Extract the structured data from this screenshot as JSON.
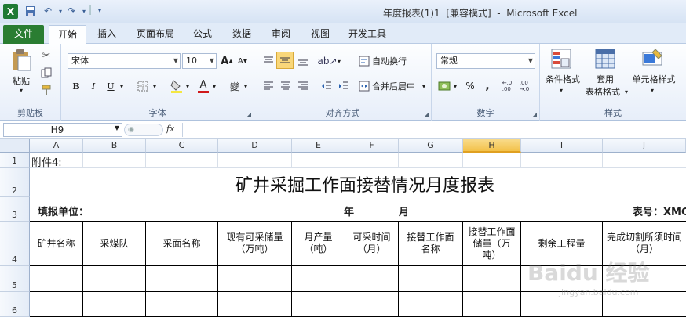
{
  "window": {
    "title": "年度报表(1)1  [兼容模式]  -  Microsoft Excel"
  },
  "quick_access": {
    "separator": "|"
  },
  "tabs": [
    "文件",
    "开始",
    "插入",
    "页面布局",
    "公式",
    "数据",
    "审阅",
    "视图",
    "开发工具"
  ],
  "clipboard": {
    "paste": "粘贴",
    "label": "剪贴板"
  },
  "font": {
    "name": "宋体",
    "size": "10",
    "bold": "B",
    "italic": "I",
    "underline": "U",
    "grow": "A",
    "shrink": "A",
    "color_a": "A",
    "phonetic": "變",
    "label": "字体"
  },
  "alignment": {
    "wrap": "自动换行",
    "merge": "合并后居中",
    "label": "对齐方式"
  },
  "number": {
    "format": "常规",
    "percent": "%",
    "comma": ",",
    "inc": ".0\n.00",
    "dec": ".00\n→.0",
    "label": "数字"
  },
  "styles": {
    "cond": "条件格式",
    "table1": "套用",
    "table2": "表格格式",
    "cell": "单元格样式",
    "label": "样式"
  },
  "formula_bar": {
    "name_box": "H9",
    "fx": "fx",
    "value": ""
  },
  "columns": [
    "A",
    "B",
    "C",
    "D",
    "E",
    "F",
    "G",
    "H",
    "I",
    "J"
  ],
  "rows": [
    "1",
    "2",
    "3",
    "4",
    "5",
    "6"
  ],
  "sheet": {
    "a1": "附件4:",
    "title": "矿井采掘工作面接替情况月度报表",
    "unit": "填报单位：",
    "year": "年",
    "month": "月",
    "form_no": "表号：XMC",
    "headers": [
      "矿井名称",
      "采煤队",
      "采面名称",
      "现有可采储量\n（万吨）",
      "月产量\n（吨）",
      "可采时间\n（月）",
      "接替工作面\n名称",
      "接替工作面\n储量（万\n吨）",
      "剩余工程量",
      "完成切割所须时间\n（月）"
    ]
  },
  "watermark": {
    "brand": "Baidu 经验",
    "url": "jingyan.baidu.com"
  },
  "colors": {
    "file_tab": "#2a7d32",
    "ribbon_accent": "#f5d26a",
    "selected_col": "#f3c14a"
  }
}
